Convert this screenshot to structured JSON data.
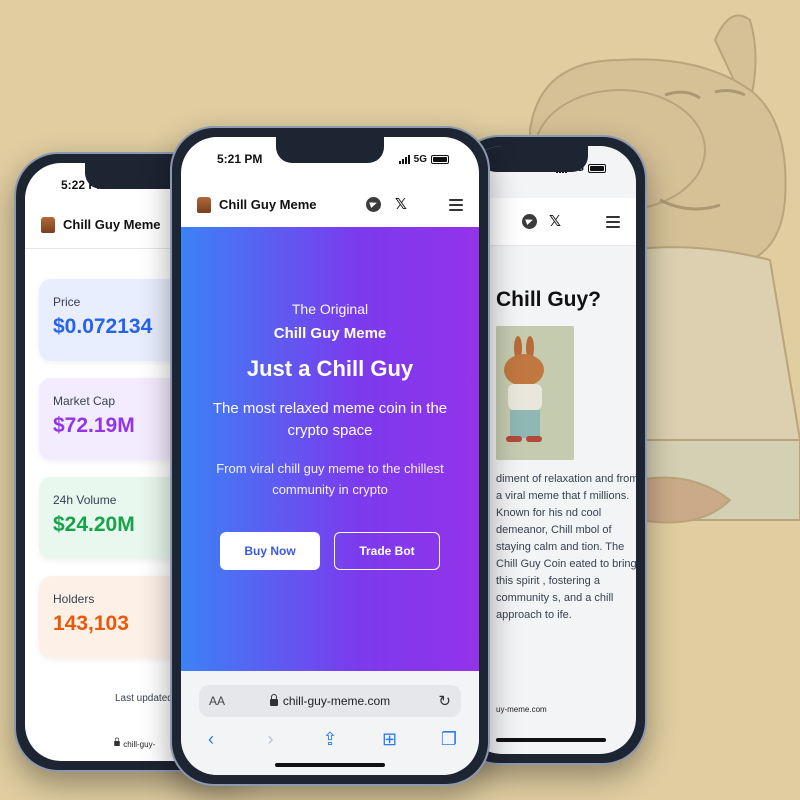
{
  "colors": {
    "background": "#e0cda0",
    "hero_gradient_start": "#3b82f6",
    "hero_gradient_end": "#9333ea",
    "price": "#2563eb",
    "market_cap": "#9333ea",
    "volume": "#16a34a",
    "holders": "#ea580c",
    "browser_accent": "#2b7de9"
  },
  "left_phone": {
    "time": "5:22 PM",
    "brand": "Chill Guy Meme",
    "stats": [
      {
        "label": "Price",
        "value": "$0.072134"
      },
      {
        "label": "Market Cap",
        "value": "$72.19M"
      },
      {
        "label": "24h Volume",
        "value": "$24.20M"
      },
      {
        "label": "Holders",
        "value": "143,103"
      }
    ],
    "updated": "Last updated:",
    "url": "chill-guy-"
  },
  "center_phone": {
    "time": "5:21 PM",
    "network": "5G",
    "brand": "Chill Guy Meme",
    "icons": [
      "telegram-icon",
      "x-icon",
      "menu-icon"
    ],
    "hero": {
      "kicker": "The Original",
      "subtitle": "Chill Guy Meme",
      "title": "Just a Chill Guy",
      "tagline": "The most relaxed meme coin in the crypto space",
      "description": "From viral chill guy meme to the chillest community in crypto",
      "buy_label": "Buy Now",
      "trade_label": "Trade Bot"
    },
    "browser": {
      "aa": "AA",
      "url": "chill-guy-meme.com",
      "toolbar": [
        "back-icon",
        "forward-icon",
        "share-icon",
        "bookmarks-icon",
        "tabs-icon"
      ]
    }
  },
  "right_phone": {
    "network": "5G",
    "heading": "Chill Guy?",
    "text": "diment of relaxation and from a viral meme that f millions. Known for his nd cool demeanor, Chill mbol of staying calm and tion. The Chill Guy Coin eated to bring this spirit , fostering a community s, and a chill approach to ife.",
    "url": "uy-meme.com"
  }
}
